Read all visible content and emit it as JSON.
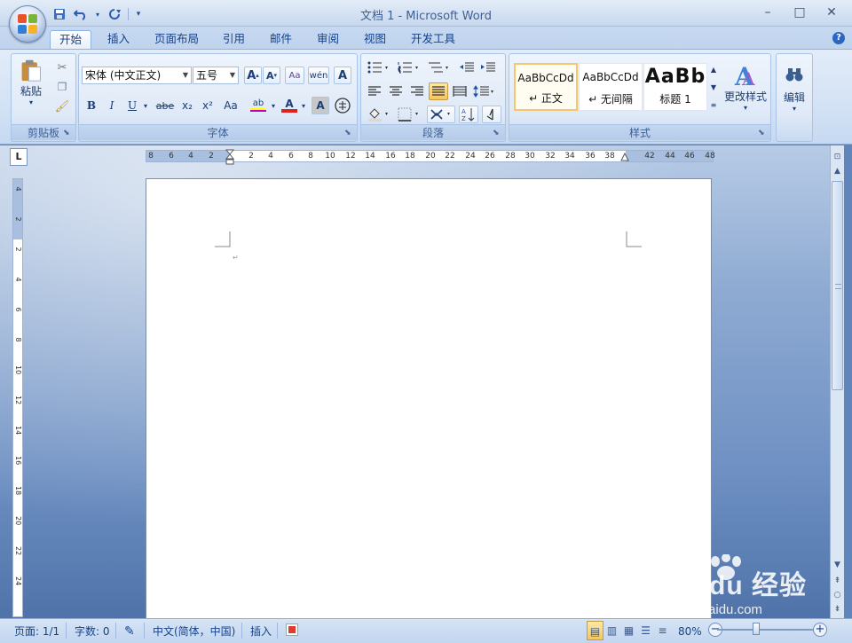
{
  "window": {
    "title": "文档 1 - Microsoft Word",
    "controls": [
      "–",
      "□",
      "✕"
    ]
  },
  "quick_access": {
    "icons": [
      "save-icon",
      "undo-icon",
      "redo-icon",
      "customize-icon"
    ]
  },
  "tabs": [
    "开始",
    "插入",
    "页面布局",
    "引用",
    "邮件",
    "审阅",
    "视图",
    "开发工具"
  ],
  "active_tab": "开始",
  "ribbon": {
    "clipboard": {
      "label": "剪贴板",
      "paste": "粘贴"
    },
    "font": {
      "label": "字体",
      "font_name": "宋体 (中文正文)",
      "font_size": "五号",
      "buttons": [
        "B",
        "I",
        "U",
        "abe",
        "x₂",
        "x²",
        "Aa",
        "A",
        "A"
      ]
    },
    "paragraph": {
      "label": "段落"
    },
    "styles": {
      "label": "样式",
      "cards": [
        {
          "sample": "AaBbCcDd",
          "name": "↵ 正文"
        },
        {
          "sample": "AaBbCcDd",
          "name": "↵ 无间隔"
        },
        {
          "sample": "AaBb",
          "name": "标题 1"
        }
      ],
      "change_styles": "更改样式"
    },
    "editing": {
      "label": "编辑"
    }
  },
  "ruler": {
    "h_ticks": [
      "8",
      "6",
      "4",
      "2",
      "2",
      "4",
      "6",
      "8",
      "10",
      "12",
      "14",
      "16",
      "18",
      "20",
      "22",
      "24",
      "26",
      "28",
      "30",
      "32",
      "34",
      "36",
      "38",
      "42",
      "44",
      "46",
      "48"
    ],
    "v_ticks": [
      "4",
      "2",
      "2",
      "4",
      "6",
      "8",
      "10",
      "12",
      "14",
      "16",
      "18",
      "20",
      "22",
      "24"
    ],
    "corner_label": "L"
  },
  "status": {
    "page": "页面: 1/1",
    "words": "字数: 0",
    "language": "中文(简体，中国)",
    "mode": "插入",
    "zoom": "80%",
    "zoom_level_pct": 80
  },
  "watermark": {
    "brand": "Bai du 经验",
    "url": "jingyan.baidu.com"
  },
  "colors": {
    "accent": "#15428b",
    "highlight": "#ffff00",
    "font_color": "#e0201b"
  }
}
